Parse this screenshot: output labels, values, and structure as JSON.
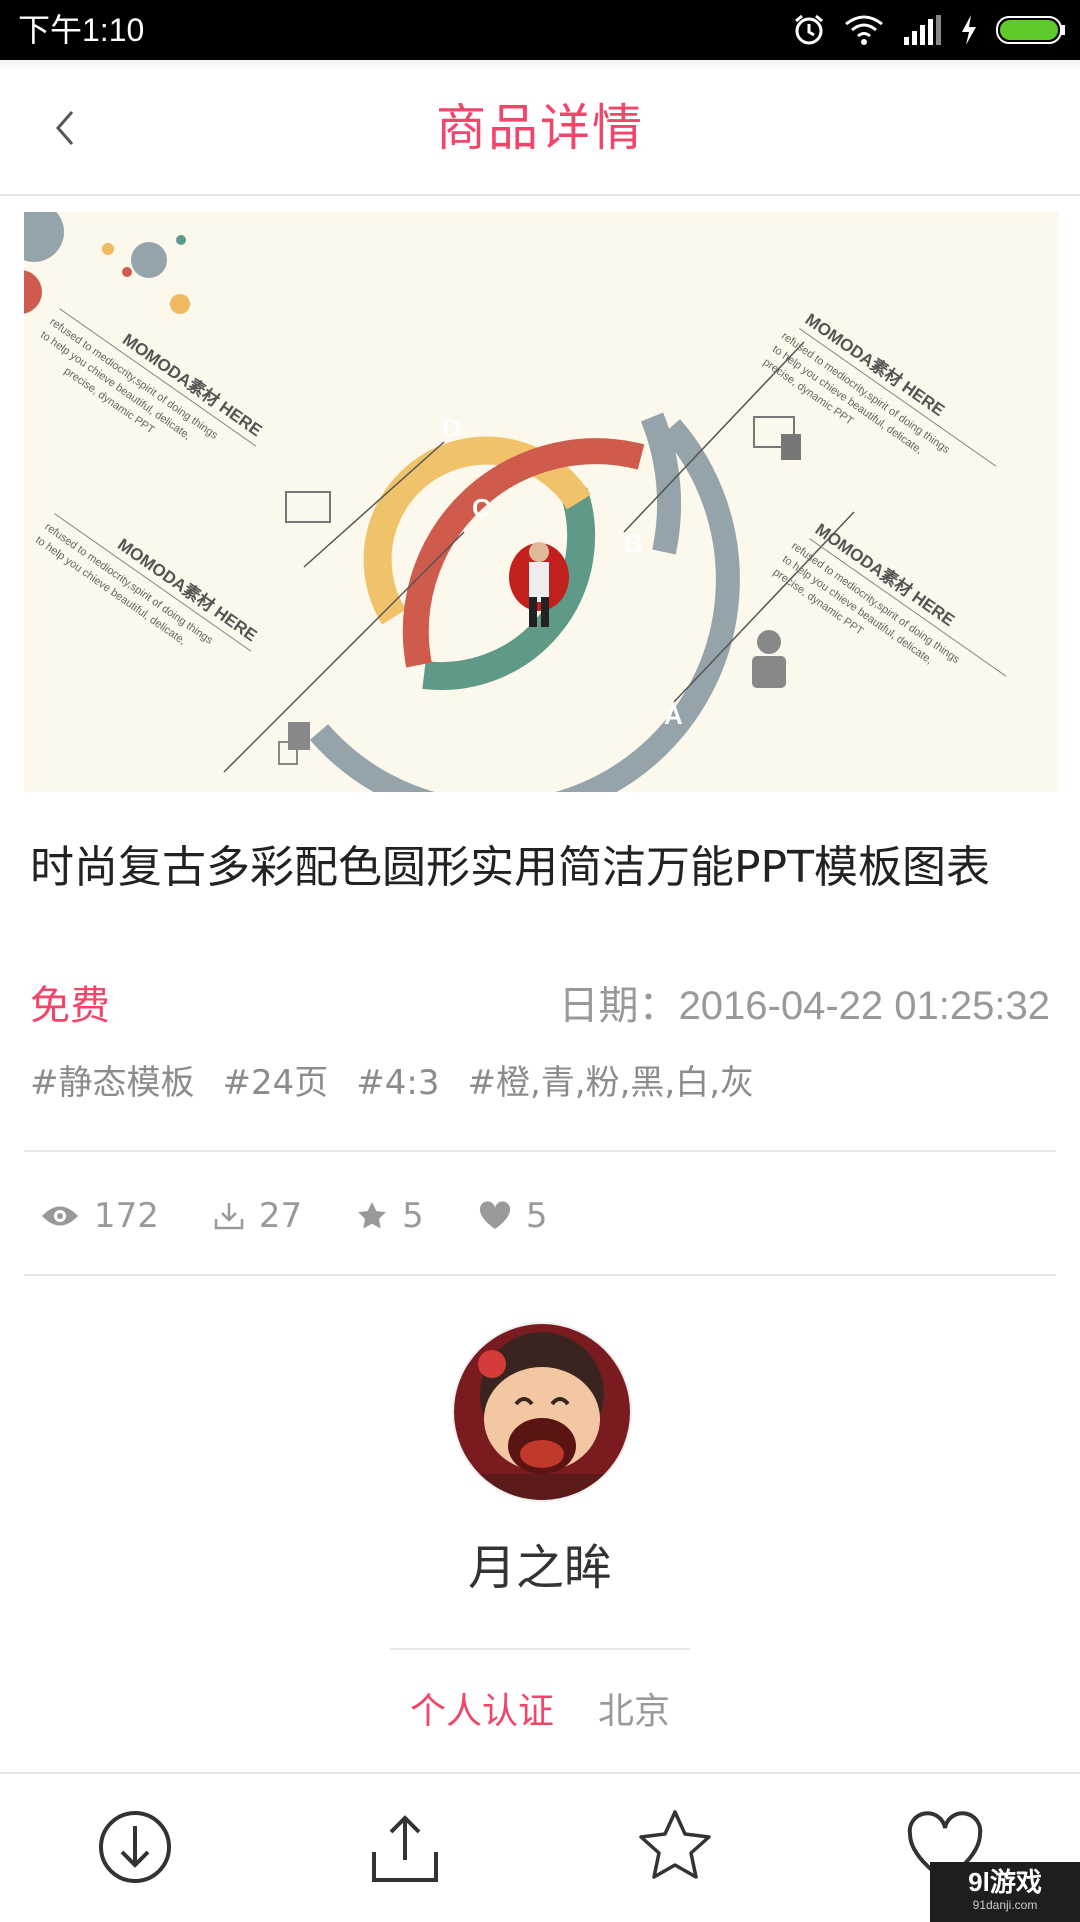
{
  "status_bar": {
    "time": "下午1:10"
  },
  "header": {
    "title": "商品详情",
    "back_icon": "chevron-left-icon"
  },
  "banner": {
    "labels": [
      "A",
      "B",
      "C",
      "D"
    ],
    "headline": "MOMODA素材 HERE",
    "body_line1": "refused  to mediocrity,spirit of doing things",
    "body_line2": "to help you chieve beautiful, delicate,",
    "body_line3": "precise, dynamic PPT"
  },
  "product": {
    "title": "时尚复古多彩配色圆形实用简洁万能PPT模板图表",
    "price": "免费",
    "date_label": "日期：",
    "date_value": "2016-04-22 01:25:32",
    "tags": [
      "#静态模板",
      "#24页",
      "#4:3",
      "#橙,青,粉,黑,白,灰"
    ]
  },
  "stats": {
    "views": "172",
    "downloads": "27",
    "stars": "5",
    "likes": "5"
  },
  "author": {
    "name": "月之眸",
    "certification": "个人认证",
    "city": "北京"
  },
  "watermark": {
    "main": "9l游戏",
    "sub": "91danji.com"
  },
  "colors": {
    "accent": "#f2456a",
    "muted": "#999999"
  }
}
